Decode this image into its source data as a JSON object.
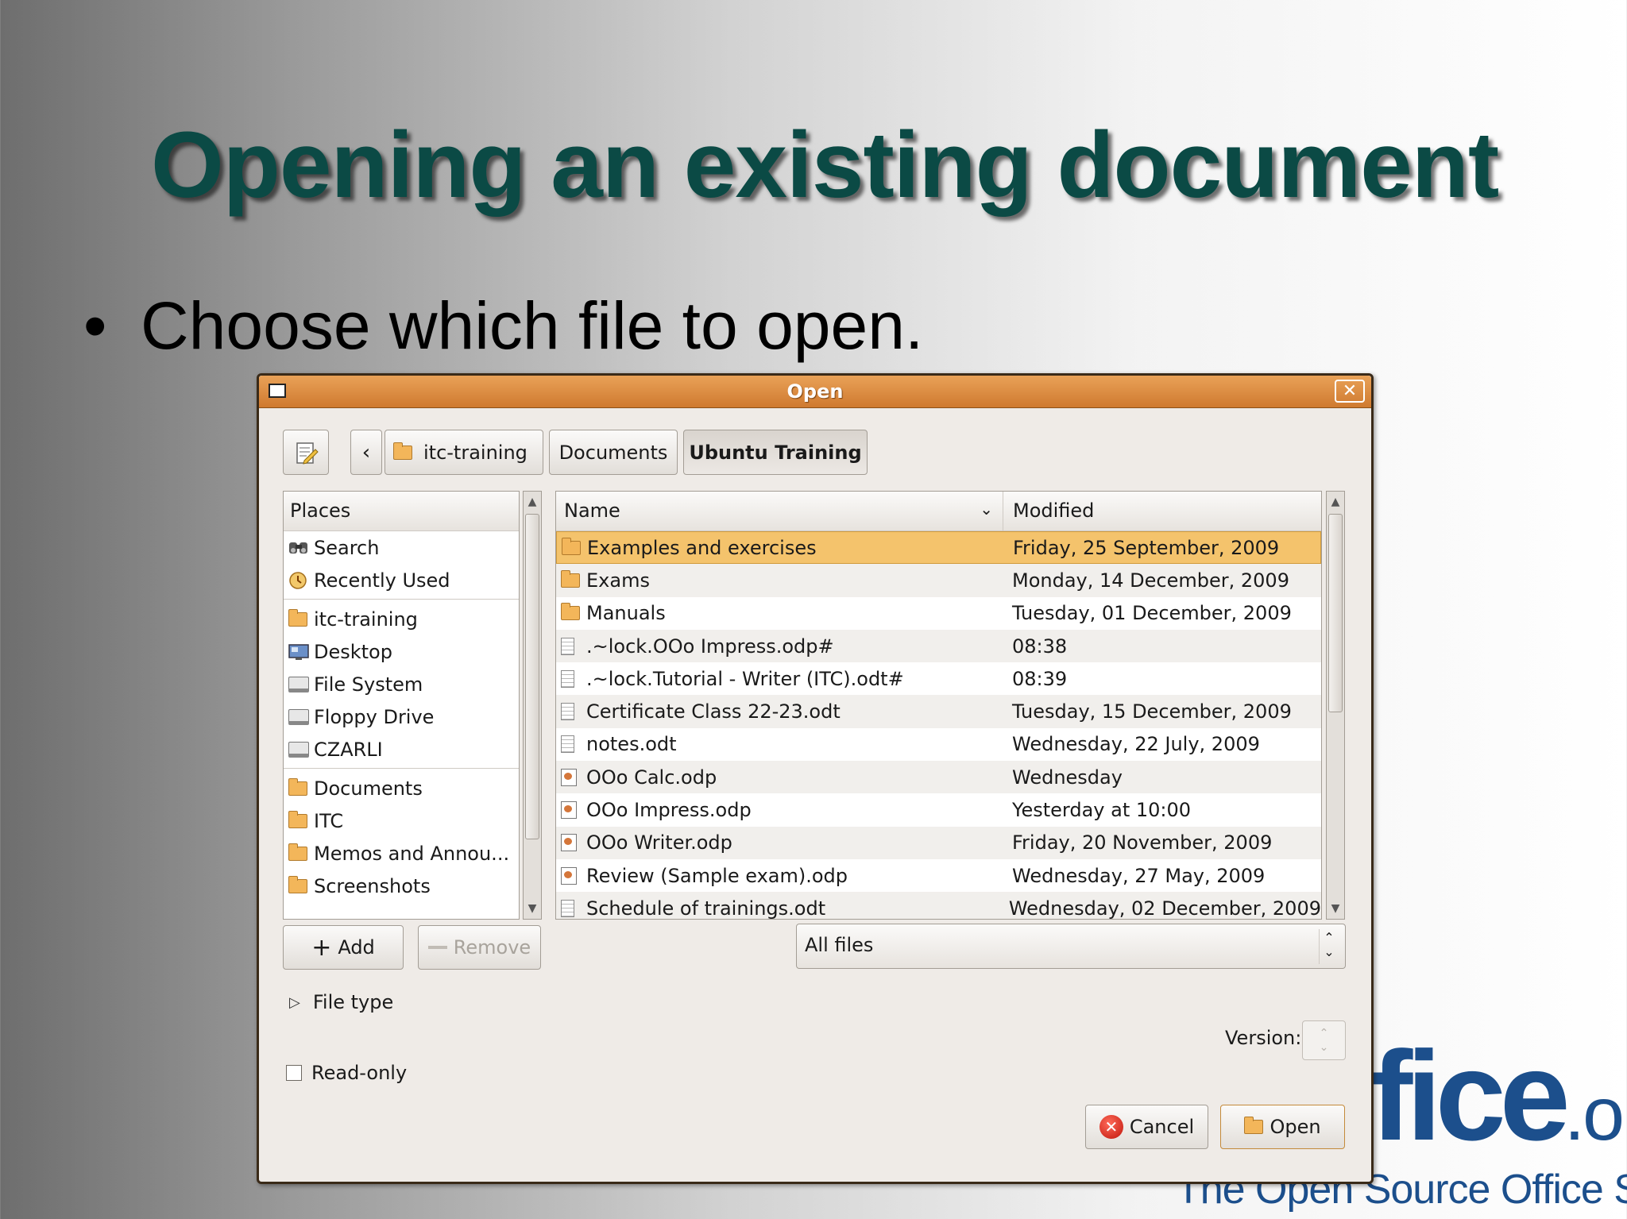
{
  "slide": {
    "title": "Opening an existing document",
    "bullet_marker": "•",
    "bullet": "Choose which file to open."
  },
  "logo": {
    "text": "fice",
    "suffix": ".org",
    "tagline": "The Open Source Office Suite"
  },
  "dialog": {
    "title": "Open",
    "close_glyph": "✕",
    "path_bar": {
      "back_glyph": "‹",
      "crumbs": [
        "itc-training",
        "Documents",
        "Ubuntu Training"
      ]
    },
    "places": {
      "header": "Places",
      "groups": [
        [
          {
            "label": "Search",
            "icon": "search-icon"
          },
          {
            "label": "Recently Used",
            "icon": "recent-icon"
          }
        ],
        [
          {
            "label": "itc-training",
            "icon": "home-folder-icon"
          },
          {
            "label": "Desktop",
            "icon": "desktop-icon"
          },
          {
            "label": "File System",
            "icon": "drive-icon"
          },
          {
            "label": "Floppy Drive",
            "icon": "floppy-icon"
          },
          {
            "label": "CZARLI",
            "icon": "drive-icon"
          }
        ],
        [
          {
            "label": "Documents",
            "icon": "folder-icon"
          },
          {
            "label": "ITC",
            "icon": "folder-icon"
          },
          {
            "label": "Memos and Annou...",
            "icon": "folder-icon"
          },
          {
            "label": "Screenshots",
            "icon": "folder-icon"
          }
        ]
      ],
      "add_label": "Add",
      "remove_label": "Remove"
    },
    "files": {
      "columns": {
        "name": "Name",
        "modified": "Modified"
      },
      "rows": [
        {
          "name": "Examples and exercises",
          "modified": "Friday, 25 September, 2009",
          "icon": "folder-icon",
          "selected": true
        },
        {
          "name": "Exams",
          "modified": "Monday, 14 December, 2009",
          "icon": "folder-icon"
        },
        {
          "name": "Manuals",
          "modified": "Tuesday, 01 December, 2009",
          "icon": "folder-icon"
        },
        {
          "name": ".~lock.OOo Impress.odp#",
          "modified": "08:38",
          "icon": "document-icon"
        },
        {
          "name": ".~lock.Tutorial - Writer (ITC).odt#",
          "modified": "08:39",
          "icon": "document-icon"
        },
        {
          "name": "Certificate Class 22-23.odt",
          "modified": "Tuesday, 15 December, 2009",
          "icon": "document-icon"
        },
        {
          "name": "notes.odt",
          "modified": "Wednesday, 22 July, 2009",
          "icon": "document-icon"
        },
        {
          "name": "OOo Calc.odp",
          "modified": "Wednesday",
          "icon": "presentation-icon"
        },
        {
          "name": "OOo Impress.odp",
          "modified": "Yesterday at 10:00",
          "icon": "presentation-icon"
        },
        {
          "name": "OOo Writer.odp",
          "modified": "Friday, 20 November, 2009",
          "icon": "presentation-icon"
        },
        {
          "name": "Review (Sample exam).odp",
          "modified": "Wednesday, 27 May, 2009",
          "icon": "presentation-icon"
        },
        {
          "name": "Schedule of trainings.odt",
          "modified": "Wednesday, 02 December, 2009",
          "icon": "document-icon"
        }
      ]
    },
    "filter": {
      "value": "All files"
    },
    "file_type_label": "File type",
    "version_label": "Version:",
    "read_only_label": "Read-only",
    "buttons": {
      "cancel": "Cancel",
      "open": "Open"
    }
  }
}
